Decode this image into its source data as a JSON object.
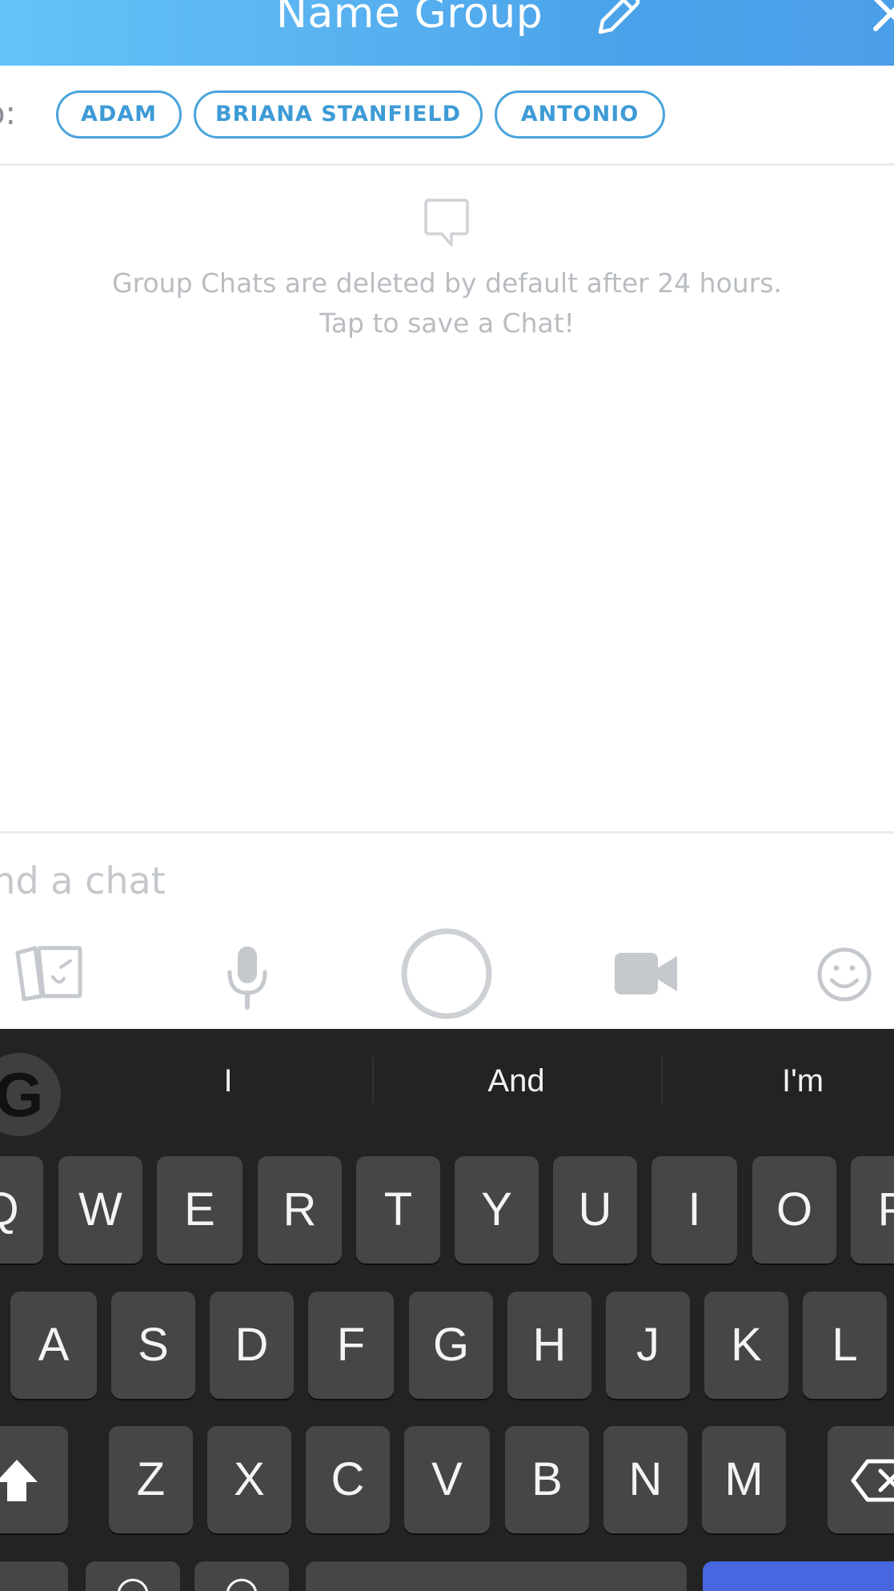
{
  "header": {
    "title": "Name Group",
    "edit_icon": "pencil-icon",
    "close_icon": "close-icon",
    "gradient_start": "#64c3f7",
    "gradient_end": "#4b9fe8"
  },
  "recipients": {
    "label": "o:",
    "chips": [
      "ADAM",
      "BRIANA STANFIELD",
      "ANTONIO"
    ],
    "chip_color": "#3d9bd6"
  },
  "chat": {
    "empty_icon": "chat-bubble-icon",
    "info_line1": "Group Chats are deleted by default after 24 hours.",
    "info_line2": "Tap to save a Chat!",
    "input_placeholder": "end a chat"
  },
  "toolbar": {
    "icons": [
      "memories-icon",
      "microphone-icon",
      "capture-button",
      "video-call-icon",
      "emoji-icon"
    ]
  },
  "keyboard": {
    "google_button": "G",
    "suggestions": [
      "I",
      "And",
      "I'm"
    ],
    "row1": [
      "Q",
      "W",
      "E",
      "R",
      "T",
      "Y",
      "U",
      "I",
      "O",
      "P"
    ],
    "row2": [
      "A",
      "S",
      "D",
      "F",
      "G",
      "H",
      "J",
      "K",
      "L"
    ],
    "row3": [
      "Z",
      "X",
      "C",
      "V",
      "B",
      "N",
      "M"
    ],
    "shift_icon": "shift-icon",
    "backspace_icon": "backspace-icon",
    "return_key_color": "#4766e0"
  }
}
